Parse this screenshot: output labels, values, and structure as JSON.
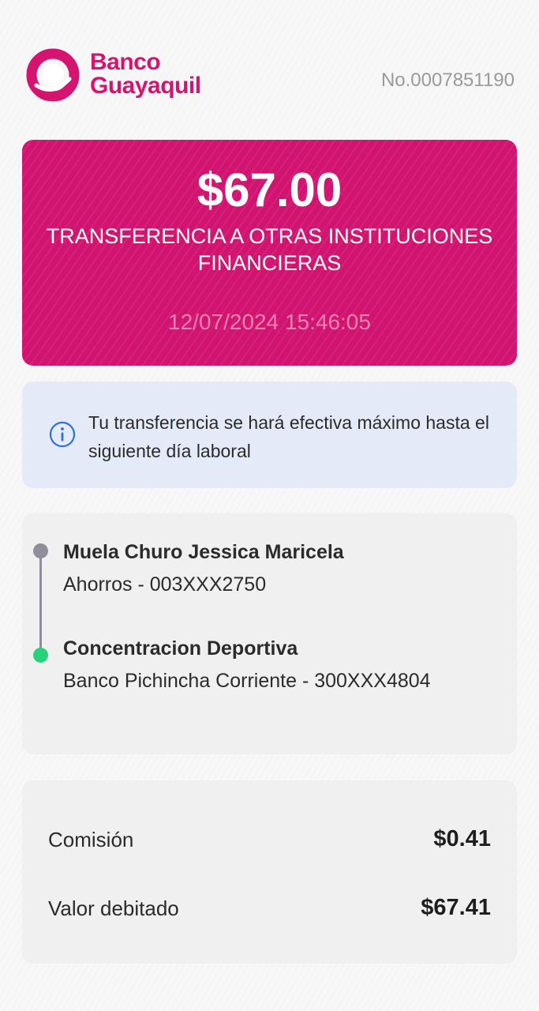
{
  "header": {
    "bank_name_line1": "Banco",
    "bank_name_line2": "Guayaquil",
    "receipt_number": "No.0007851190"
  },
  "transaction": {
    "amount": "$67.00",
    "type": "TRANSFERENCIA A OTRAS INSTITUCIONES FINANCIERAS",
    "datetime": "12/07/2024 15:46:05"
  },
  "notice": {
    "icon": "info-icon",
    "text": "Tu transferencia se hará efectiva máximo hasta el siguiente día laboral"
  },
  "origin": {
    "name": "Muela Churo Jessica Maricela",
    "account": "Ahorros - 003XXX2750"
  },
  "destination": {
    "name": "Concentracion Deportiva",
    "account": "Banco Pichincha Corriente - 300XXX4804"
  },
  "totals": {
    "commission_label": "Comisión",
    "commission_value": "$0.41",
    "debited_label": "Valor debitado",
    "debited_value": "$67.41"
  },
  "colors": {
    "brand": "#d4146f",
    "card": "#d11470",
    "info_bg": "#e4eaf7",
    "info_icon": "#2f6fe0",
    "origin_dot": "#8f8f9c",
    "destination_dot": "#26d37a"
  }
}
